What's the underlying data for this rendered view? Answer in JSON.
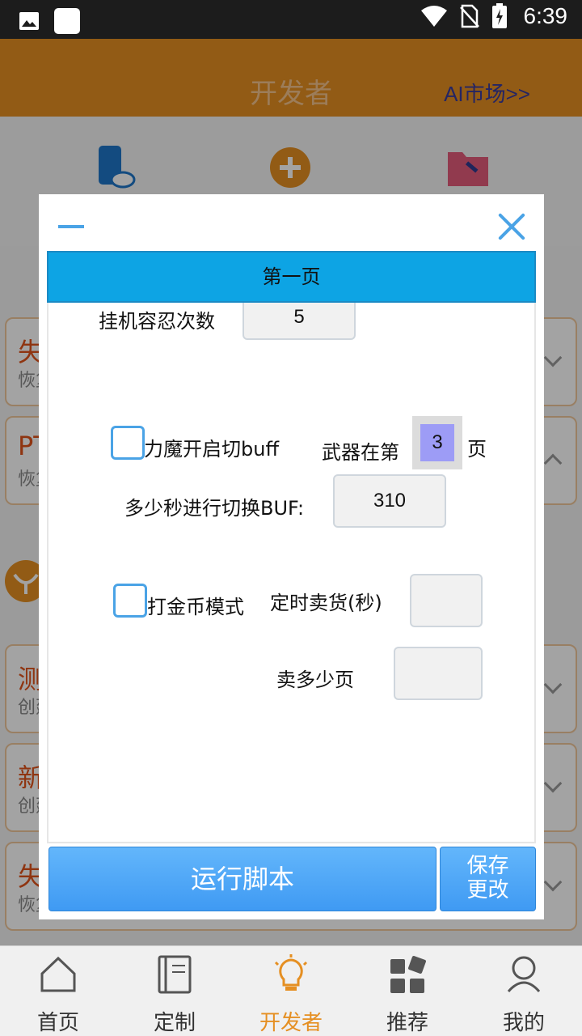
{
  "status_bar": {
    "time": "6:39"
  },
  "header": {
    "title": "开发者",
    "ai_market_link": "AI市场>>"
  },
  "background_cards": [
    {
      "title_partial": "失",
      "subtitle_partial": "恢复"
    },
    {
      "title_partial": "PT",
      "subtitle_partial": "恢复"
    },
    {
      "title_partial": "测",
      "subtitle_partial": "创建"
    },
    {
      "title_partial": "新",
      "subtitle_partial": "创建"
    },
    {
      "title_partial": "失",
      "subtitle_partial": "恢复"
    }
  ],
  "dialog": {
    "tab_label": "第一页",
    "fields": {
      "idle_tolerance_label": "挂机容忍次数",
      "idle_tolerance_value": "5",
      "power_buff_label": "力魔开启切buff",
      "power_buff_checked": false,
      "weapon_page_label": "武器在第",
      "weapon_page_value": "3",
      "weapon_page_unit": "页",
      "buff_interval_label": "多少秒进行切换BUF:",
      "buff_interval_value": "310",
      "gold_mode_label": "打金币模式",
      "gold_mode_checked": false,
      "timed_sell_label": "定时卖货(秒)",
      "timed_sell_value": "",
      "sell_pages_label": "卖多少页",
      "sell_pages_value": ""
    },
    "run_button": "运行脚本",
    "save_button_line1": "保存",
    "save_button_line2": "更改"
  },
  "bottom_nav": [
    {
      "label": "首页",
      "icon": "home-icon"
    },
    {
      "label": "定制",
      "icon": "notebook-icon"
    },
    {
      "label": "开发者",
      "icon": "lightbulb-icon",
      "active": true
    },
    {
      "label": "推荐",
      "icon": "grid-icon"
    },
    {
      "label": "我的",
      "icon": "profile-icon"
    }
  ],
  "colors": {
    "accent": "#e58f22",
    "tab_blue": "#0da4e4",
    "button_blue": "#4ea8f7"
  }
}
